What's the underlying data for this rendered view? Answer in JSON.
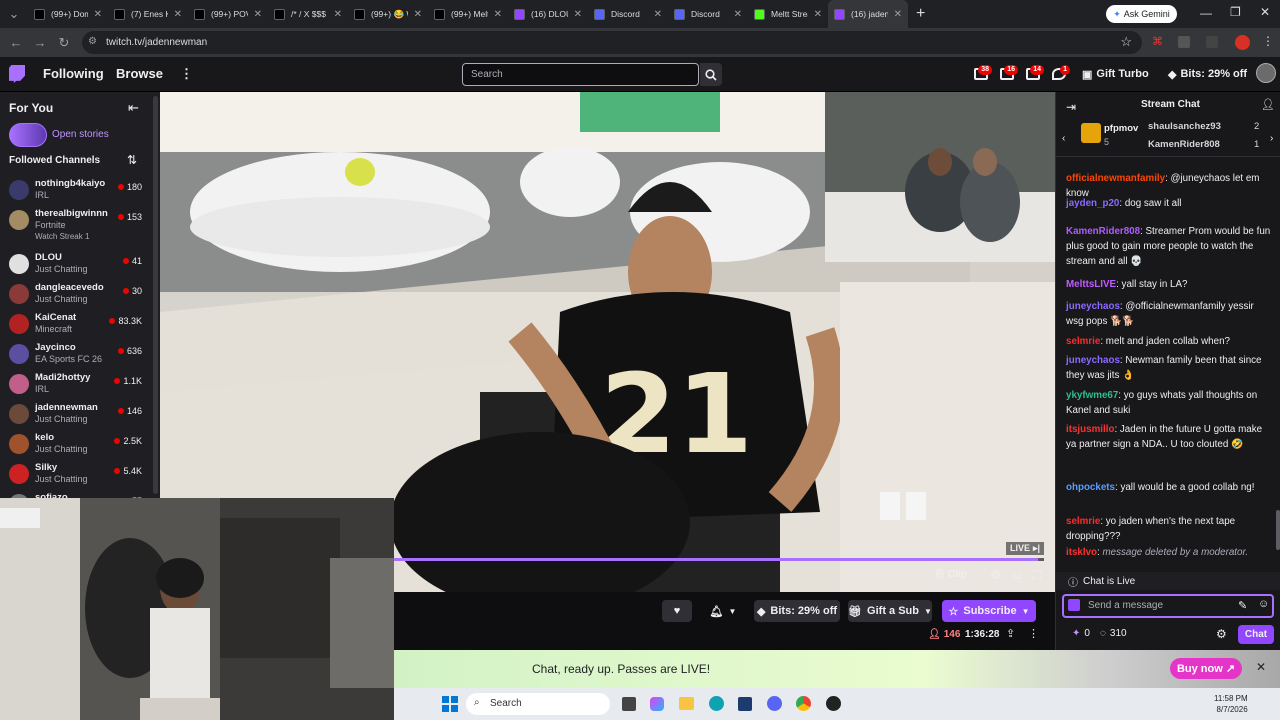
{
  "browser": {
    "tabs": [
      {
        "title": "(99+) Domin",
        "icon": "tiktok-icon",
        "color": "#000000"
      },
      {
        "title": "(7) Enes Kan",
        "icon": "x-icon",
        "color": "#000000"
      },
      {
        "title": "(99+) POV: H",
        "icon": "tiktok-icon",
        "color": "#000000"
      },
      {
        "title": "/* / X $$$ (7)",
        "icon": "x-icon",
        "color": "#000000"
      },
      {
        "title": "(99+) 😂 W",
        "icon": "tiktok-icon",
        "color": "#000000"
      },
      {
        "title": "(99+) Melt a",
        "icon": "tiktok-icon",
        "color": "#000000"
      },
      {
        "title": "(16) DLOU -",
        "icon": "twitch-icon",
        "color": "#9146ff"
      },
      {
        "title": "Discord",
        "icon": "discord-icon",
        "color": "#5865f2"
      },
      {
        "title": "Discord",
        "icon": "discord-icon",
        "color": "#5865f2"
      },
      {
        "title": "Meltt Strear",
        "icon": "kick-icon",
        "color": "#53fc18"
      },
      {
        "title": "(16) jadenne",
        "icon": "twitch-icon",
        "color": "#9146ff"
      }
    ],
    "ask_gemini": "Ask Gemini",
    "url": "twitch.tv/jadennewman"
  },
  "topnav": {
    "following": "Following",
    "browse": "Browse",
    "search_placeholder": "Search",
    "badges": [
      "38",
      "16",
      "14",
      "1"
    ],
    "gift_turbo": "Gift Turbo",
    "bits": "Bits: 29% off"
  },
  "sidebar": {
    "for_you": "For You",
    "open_stories": "Open stories",
    "followed_channels": "Followed Channels",
    "channels": [
      {
        "name": "nothingb4kaiyo",
        "game": "IRL",
        "viewers": "180",
        "color": "#3b3b6b"
      },
      {
        "name": "therealbigwinnn",
        "game": "Fortnite",
        "viewers": "153",
        "extra": "Watch Streak 1",
        "color": "#a38b63"
      },
      {
        "name": "DLOU",
        "game": "Just Chatting",
        "viewers": "41",
        "color": "#e0e0e0"
      },
      {
        "name": "dangleacevedo",
        "game": "Just Chatting",
        "viewers": "30",
        "color": "#8b3a3a"
      },
      {
        "name": "KaiCenat",
        "game": "Minecraft",
        "viewers": "83.3K",
        "color": "#b22222"
      },
      {
        "name": "Jaycinco",
        "game": "EA Sports FC 26",
        "viewers": "636",
        "color": "#5a4fa0"
      },
      {
        "name": "Madi2hottyy",
        "game": "IRL",
        "viewers": "1.1K",
        "color": "#c0608a"
      },
      {
        "name": "jadennewman",
        "game": "Just Chatting",
        "viewers": "146",
        "color": "#6b4a3a"
      },
      {
        "name": "kelo",
        "game": "Just Chatting",
        "viewers": "2.5K",
        "color": "#a0522d"
      },
      {
        "name": "Silky",
        "game": "Just Chatting",
        "viewers": "5.4K",
        "color": "#cc2222"
      },
      {
        "name": "sofiazo",
        "game": "",
        "viewers": "55",
        "color": "#777777"
      }
    ]
  },
  "player": {
    "live": "LIVE",
    "progress": 0.99,
    "clip": "Clip"
  },
  "info": {
    "bits": "Bits: 29% off",
    "gift_sub": "Gift a Sub",
    "subscribe": "Subscribe",
    "viewers": "146",
    "uptime": "1:36:28"
  },
  "chat": {
    "title": "Stream Chat",
    "gifters": [
      {
        "name": "pfpmov",
        "count": "5"
      },
      {
        "name": "shaulsanchez93",
        "count": "2"
      },
      {
        "name": "KamenRider808",
        "count": "1"
      }
    ],
    "messages": [
      {
        "user": "officialnewmanfamily",
        "color": "#ff4500",
        "text": "@juneychaos let em know"
      },
      {
        "user": "jayden_p20",
        "color": "#8a6bff",
        "text": "dog saw it all"
      },
      {
        "user": "KamenRider808",
        "color": "#b05cff",
        "text": "Streamer Prom would be fun plus good to gain more people to watch the stream and all 💀"
      },
      {
        "user": "MelttsLIVE",
        "color": "#c05cff",
        "text": "yall stay in LA?"
      },
      {
        "user": "juneychaos",
        "color": "#8a6bff",
        "text": "@officialnewmanfamily yessir wsg pops 🐕🐕"
      },
      {
        "user": "selmrie",
        "color": "#ff2b2b",
        "text": "melt and jaden collab when?"
      },
      {
        "user": "juneychaos",
        "color": "#8a6bff",
        "text": "Newman family been that since they was jits 👌"
      },
      {
        "user": "ykyfwme67",
        "color": "#2ebd8f",
        "text": "yo guys whats yall thoughts on Kanel and suki"
      },
      {
        "user": "itsjusmillo",
        "color": "#ff3030",
        "text": "Jaden in the future U gotta make ya partner sign a NDA.. U too clouted 🤣"
      },
      {
        "user": "ohpockets",
        "color": "#5b9bff",
        "text": "yall would be a good collab ng!"
      },
      {
        "user": "selmrie",
        "color": "#ff2b2b",
        "text": "yo jaden when's the next tape dropping???"
      },
      {
        "user": "itsklvo",
        "color": "#ff3030",
        "text": "message deleted by a moderator."
      }
    ],
    "chat_is_live": "Chat is Live",
    "send_placeholder": "Send a message",
    "points_a": "0",
    "points_b": "310",
    "chat_button": "Chat"
  },
  "banner": {
    "text": "Chat, ready up. Passes are LIVE!",
    "buy_now": "Buy now"
  },
  "taskbar": {
    "search": "Search",
    "time": "11:58 PM",
    "date": "8/7/2026"
  },
  "colors": {
    "twitch_purple": "#9146ff",
    "accent": "#a970ff",
    "live_red": "#eb0400"
  }
}
